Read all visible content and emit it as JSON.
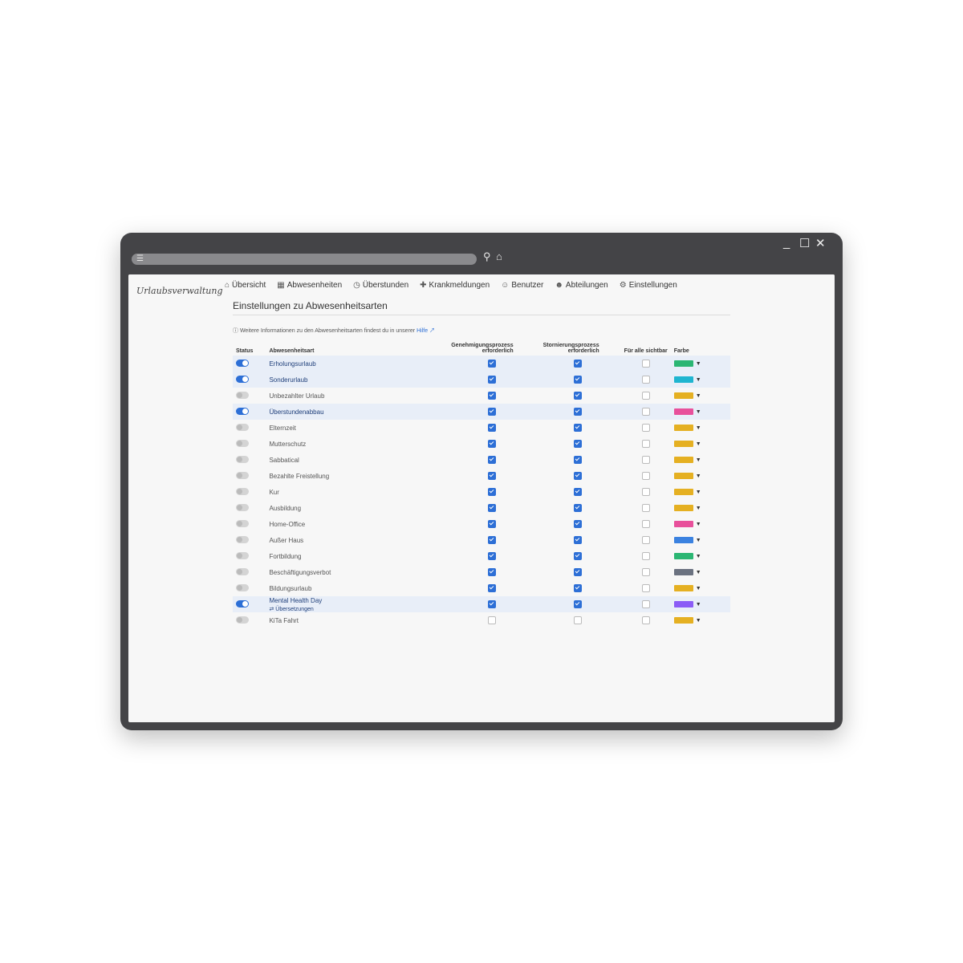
{
  "window": {
    "controls": {
      "minimize": "_",
      "maximize": "☐",
      "close": "✕"
    }
  },
  "brand": "Urlaubsverwaltung",
  "nav": [
    {
      "label": "Übersicht",
      "icon": "home-icon"
    },
    {
      "label": "Abwesenheiten",
      "icon": "calendar-icon"
    },
    {
      "label": "Überstunden",
      "icon": "clock-icon"
    },
    {
      "label": "Krankmeldungen",
      "icon": "medical-icon"
    },
    {
      "label": "Benutzer",
      "icon": "user-icon"
    },
    {
      "label": "Abteilungen",
      "icon": "users-icon"
    },
    {
      "label": "Einstellungen",
      "icon": "gear-icon"
    }
  ],
  "page": {
    "title": "Einstellungen zu Abwesenheitsarten",
    "info_text": "Weitere Informationen zu den Abwesenheitsarten findest du in unserer",
    "info_link": "Hilfe"
  },
  "table": {
    "headers": {
      "status": "Status",
      "type": "Abwesenheitsart",
      "approval": "Genehmigungsprozess erforderlich",
      "cancellation": "Stornierungsprozess erforderlich",
      "visible": "Für alle sichtbar",
      "color": "Farbe"
    },
    "rows": [
      {
        "name": "Erholungsurlaub",
        "active": true,
        "approval": true,
        "cancellation": true,
        "visible": false,
        "color": "#2bb673"
      },
      {
        "name": "Sonderurlaub",
        "active": true,
        "approval": true,
        "cancellation": true,
        "visible": false,
        "color": "#1fb5d0"
      },
      {
        "name": "Unbezahlter Urlaub",
        "active": false,
        "approval": true,
        "cancellation": true,
        "visible": false,
        "color": "#e5b022"
      },
      {
        "name": "Überstundenabbau",
        "active": true,
        "approval": true,
        "cancellation": true,
        "visible": false,
        "color": "#e8509b"
      },
      {
        "name": "Elternzeit",
        "active": false,
        "approval": true,
        "cancellation": true,
        "visible": false,
        "color": "#e5b022"
      },
      {
        "name": "Mutterschutz",
        "active": false,
        "approval": true,
        "cancellation": true,
        "visible": false,
        "color": "#e5b022"
      },
      {
        "name": "Sabbatical",
        "active": false,
        "approval": true,
        "cancellation": true,
        "visible": false,
        "color": "#e5b022"
      },
      {
        "name": "Bezahlte Freistellung",
        "active": false,
        "approval": true,
        "cancellation": true,
        "visible": false,
        "color": "#e5b022"
      },
      {
        "name": "Kur",
        "active": false,
        "approval": true,
        "cancellation": true,
        "visible": false,
        "color": "#e5b022"
      },
      {
        "name": "Ausbildung",
        "active": false,
        "approval": true,
        "cancellation": true,
        "visible": false,
        "color": "#e5b022"
      },
      {
        "name": "Home-Office",
        "active": false,
        "approval": true,
        "cancellation": true,
        "visible": false,
        "color": "#e8509b"
      },
      {
        "name": "Außer Haus",
        "active": false,
        "approval": true,
        "cancellation": true,
        "visible": false,
        "color": "#3b82e0"
      },
      {
        "name": "Fortbildung",
        "active": false,
        "approval": true,
        "cancellation": true,
        "visible": false,
        "color": "#2bb673"
      },
      {
        "name": "Beschäftigungsverbot",
        "active": false,
        "approval": true,
        "cancellation": true,
        "visible": false,
        "color": "#6b7280"
      },
      {
        "name": "Bildungsurlaub",
        "active": false,
        "approval": true,
        "cancellation": true,
        "visible": false,
        "color": "#e5b022"
      },
      {
        "name": "Mental Health Day",
        "active": true,
        "approval": true,
        "cancellation": true,
        "visible": false,
        "color": "#8b5cf6",
        "sub": "Übersetzungen"
      },
      {
        "name": "KiTa Fahrt",
        "active": false,
        "approval": false,
        "cancellation": false,
        "visible": false,
        "color": "#e5b022"
      }
    ]
  }
}
